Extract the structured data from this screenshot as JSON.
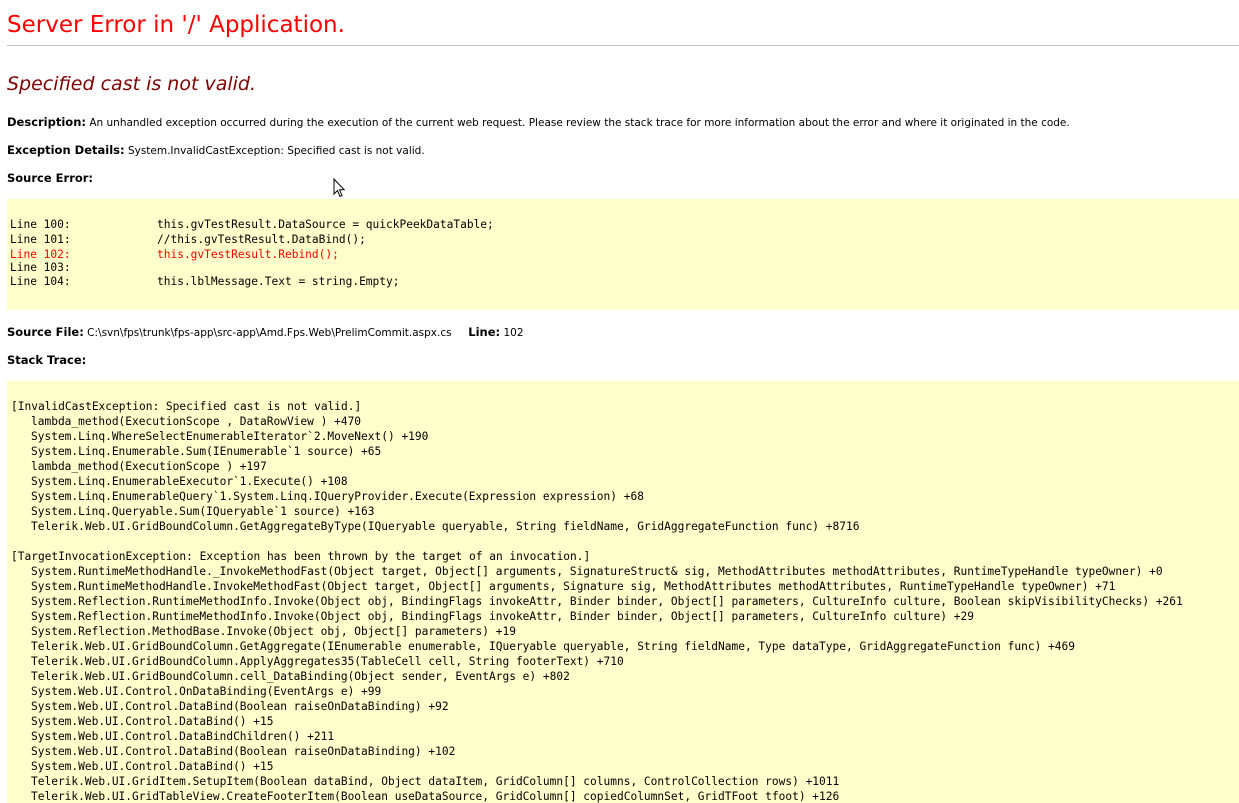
{
  "title": "Server Error in '/' Application.",
  "subtitle": "Specified cast is not valid.",
  "description": {
    "label": "Description:",
    "text": "An unhandled exception occurred during the execution of the current web request. Please review the stack trace for more information about the error and where it originated in the code."
  },
  "exception_details": {
    "label": "Exception Details:",
    "text": "System.InvalidCastException: Specified cast is not valid."
  },
  "source_error": {
    "label": "Source Error:",
    "lines": [
      {
        "num": "Line 100:",
        "code": "this.gvTestResult.DataSource = quickPeekDataTable;",
        "error": false
      },
      {
        "num": "Line 101:",
        "code": "//this.gvTestResult.DataBind();",
        "error": false
      },
      {
        "num": "Line 102:",
        "code": "this.gvTestResult.Rebind();",
        "error": true
      },
      {
        "num": "Line 103:",
        "code": "",
        "error": false
      },
      {
        "num": "Line 104:",
        "code": "this.lblMessage.Text = string.Empty;",
        "error": false
      }
    ]
  },
  "source_file": {
    "label": "Source File:",
    "path": "C:\\svn\\fps\\trunk\\fps-app\\src-app\\Amd.Fps.Web\\PrelimCommit.aspx.cs",
    "line_label": "Line:",
    "line_value": "102"
  },
  "stack_trace": {
    "label": "Stack Trace:",
    "blocks": [
      {
        "header": "[InvalidCastException: Specified cast is not valid.]",
        "frames": [
          "lambda_method(ExecutionScope , DataRowView ) +470",
          "System.Linq.WhereSelectEnumerableIterator`2.MoveNext() +190",
          "System.Linq.Enumerable.Sum(IEnumerable`1 source) +65",
          "lambda_method(ExecutionScope ) +197",
          "System.Linq.EnumerableExecutor`1.Execute() +108",
          "System.Linq.EnumerableQuery`1.System.Linq.IQueryProvider.Execute(Expression expression) +68",
          "System.Linq.Queryable.Sum(IQueryable`1 source) +163",
          "Telerik.Web.UI.GridBoundColumn.GetAggregateByType(IQueryable queryable, String fieldName, GridAggregateFunction func) +8716"
        ]
      },
      {
        "header": "[TargetInvocationException: Exception has been thrown by the target of an invocation.]",
        "frames": [
          "System.RuntimeMethodHandle._InvokeMethodFast(Object target, Object[] arguments, SignatureStruct& sig, MethodAttributes methodAttributes, RuntimeTypeHandle typeOwner) +0",
          "System.RuntimeMethodHandle.InvokeMethodFast(Object target, Object[] arguments, Signature sig, MethodAttributes methodAttributes, RuntimeTypeHandle typeOwner) +71",
          "System.Reflection.RuntimeMethodInfo.Invoke(Object obj, BindingFlags invokeAttr, Binder binder, Object[] parameters, CultureInfo culture, Boolean skipVisibilityChecks) +261",
          "System.Reflection.RuntimeMethodInfo.Invoke(Object obj, BindingFlags invokeAttr, Binder binder, Object[] parameters, CultureInfo culture) +29",
          "System.Reflection.MethodBase.Invoke(Object obj, Object[] parameters) +19",
          "Telerik.Web.UI.GridBoundColumn.GetAggregate(IEnumerable enumerable, IQueryable queryable, String fieldName, Type dataType, GridAggregateFunction func) +469",
          "Telerik.Web.UI.GridBoundColumn.ApplyAggregates35(TableCell cell, String footerText) +710",
          "Telerik.Web.UI.GridBoundColumn.cell_DataBinding(Object sender, EventArgs e) +802",
          "System.Web.UI.Control.OnDataBinding(EventArgs e) +99",
          "System.Web.UI.Control.DataBind(Boolean raiseOnDataBinding) +92",
          "System.Web.UI.Control.DataBind() +15",
          "System.Web.UI.Control.DataBindChildren() +211",
          "System.Web.UI.Control.DataBind(Boolean raiseOnDataBinding) +102",
          "System.Web.UI.Control.DataBind() +15",
          "Telerik.Web.UI.GridItem.SetupItem(Boolean dataBind, Object dataItem, GridColumn[] columns, ControlCollection rows) +1011",
          "Telerik.Web.UI.GridTableView.CreateFooterItem(Boolean useDataSource, GridColumn[] copiedColumnSet, GridTFoot tfoot) +126"
        ]
      }
    ]
  },
  "colors": {
    "title": "#ff0000",
    "subtitle": "#800000",
    "code_background": "#ffffcc",
    "error_line": "#ff0000"
  },
  "icons": {
    "cursor": "mouse-pointer-icon"
  }
}
